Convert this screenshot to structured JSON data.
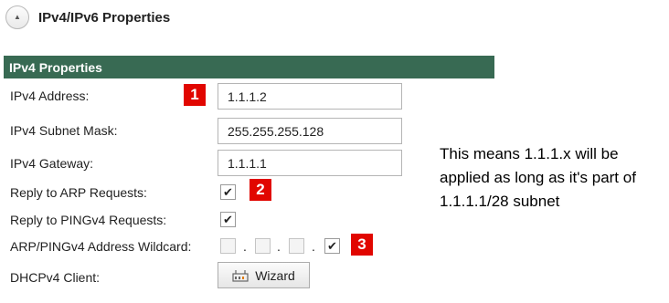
{
  "section": {
    "title": "IPv4/IPv6 Properties",
    "toggle_icon": "▲"
  },
  "panel": {
    "title": "IPv4 Properties"
  },
  "rows": {
    "address": {
      "label": "IPv4 Address:",
      "value": "1.1.1.2"
    },
    "subnet": {
      "label": "IPv4 Subnet Mask:",
      "value": "255.255.255.128"
    },
    "gateway": {
      "label": "IPv4 Gateway:",
      "value": "1.1.1.1"
    },
    "reply_arp": {
      "label": "Reply to ARP Requests:",
      "checked": true
    },
    "reply_ping": {
      "label": "Reply to PINGv4 Requests:",
      "checked": true
    },
    "wildcard": {
      "label": "ARP/PINGv4 Address Wildcard:",
      "octets_checked": [
        false,
        false,
        false,
        true
      ],
      "separator": "."
    },
    "dhcp": {
      "label": "DHCPv4 Client:",
      "button_label": "Wizard"
    }
  },
  "badges": [
    "1",
    "2",
    "3"
  ],
  "note": "This means 1.1.1.x will be applied as long as it's part of 1.1.1.1/28 subnet",
  "colors": {
    "panel_header": "#386a53",
    "badge": "#e10600"
  },
  "icons": {
    "wizard": "wizard-icon",
    "check": "✔"
  }
}
